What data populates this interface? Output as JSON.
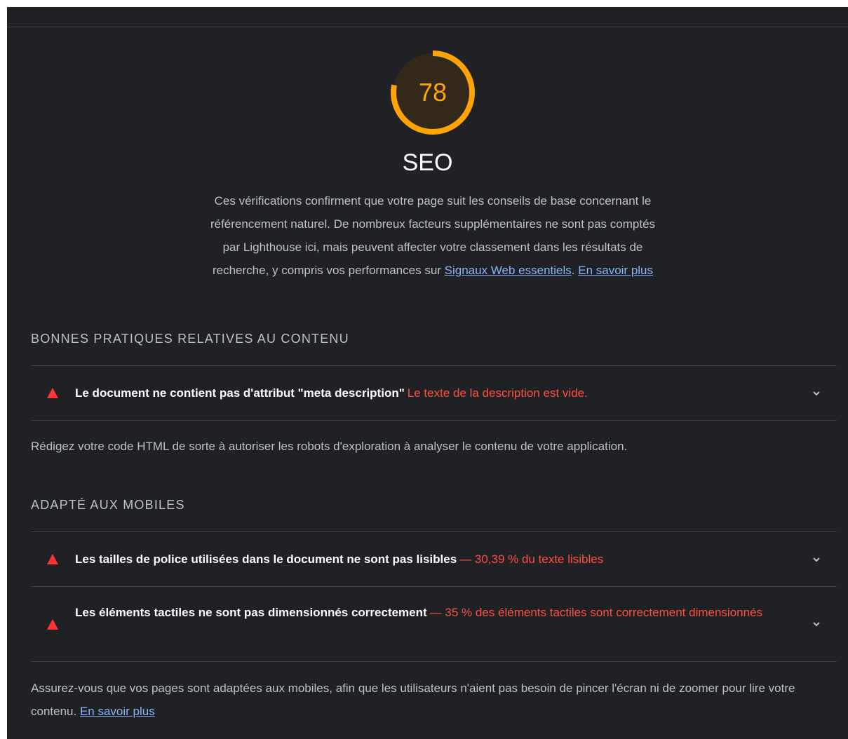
{
  "category": {
    "score": "78",
    "score_fraction": 0.78,
    "title": "SEO",
    "description_text": "Ces vérifications confirment que votre page suit les conseils de base concernant le référencement naturel. De nombreux facteurs supplémentaires ne sont pas comptés par Lighthouse ici, mais peuvent affecter votre classement dans les résultats de recherche, y compris vos performances sur ",
    "core_web_vitals_link": "Signaux Web essentiels",
    "separator": ". ",
    "learn_more_link": "En savoir plus"
  },
  "groups": {
    "content": {
      "title": "BONNES PRATIQUES RELATIVES AU CONTENU",
      "description": "Rédigez votre code HTML de sorte à autoriser les robots d'exploration à analyser le contenu de votre application.",
      "audits": [
        {
          "title": "Le document ne contient pas d'attribut \"meta description\"",
          "display": "Le texte de la description est vide."
        }
      ]
    },
    "mobile": {
      "title": "ADAPTÉ AUX MOBILES",
      "description": "Assurez-vous que vos pages sont adaptées aux mobiles, afin que les utilisateurs n'aient pas besoin de pincer l'écran ni de zoomer pour lire votre contenu. ",
      "learn_more_link": "En savoir plus",
      "audits": [
        {
          "title": "Les tailles de police utilisées dans le document ne sont pas lisibles",
          "display": "— 30,39 % du texte lisibles"
        },
        {
          "title": "Les éléments tactiles ne sont pas dimensionnés correctement",
          "display": "— 35 % des éléments tactiles sont correctement dimensionnés"
        }
      ]
    }
  },
  "colors": {
    "background": "#202124",
    "gauge_average": "#ffa400",
    "fail": "#ff3333",
    "link": "#8ab4f8"
  },
  "icons": {
    "fail": "fail-triangle-icon",
    "expand": "chevron-down-icon"
  }
}
